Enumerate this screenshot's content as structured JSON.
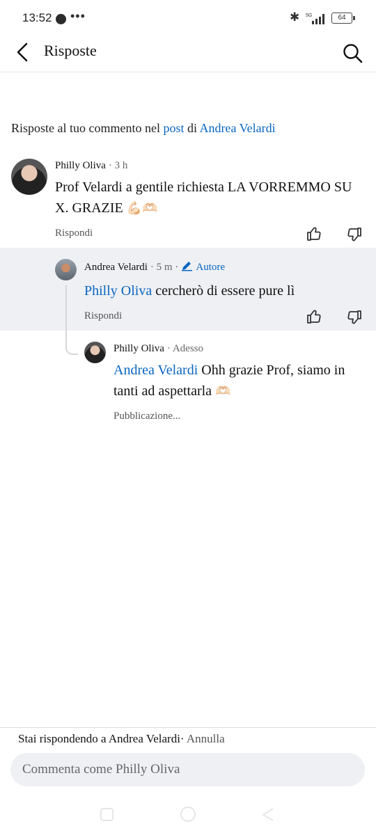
{
  "status_bar": {
    "time": "13:52",
    "battery": "64",
    "network": "5G"
  },
  "header": {
    "title": "Risposte"
  },
  "breadcrumb": {
    "prefix": "Risposte al tuo commento nel",
    "post_link": "post",
    "middle": "di",
    "author_link": "Andrea Velardi"
  },
  "comments": [
    {
      "name": "Philly Oliva",
      "time": "· 3 h",
      "text": "Prof Velardi a gentile richiesta LA VORREMMO SU X. GRAZIE",
      "emoji": "💪🏻🫶🏻",
      "reply_label": "Rispondi"
    },
    {
      "name": "Andrea Velardi",
      "time": "· 5 m ·",
      "badge": "Autore",
      "mention": "Philly Oliva",
      "text": "cercherò di essere pure lì",
      "reply_label": "Rispondi"
    },
    {
      "name": "Philly Oliva",
      "time": "· Adesso",
      "mention": "Andrea Velardi",
      "text": "Ohh grazie Prof, siamo in tanti ad aspettarla",
      "emoji": "🫶🏻",
      "status": "Pubblicazione..."
    }
  ],
  "reply_bar": {
    "prefix": "Stai rispondendo a",
    "target": "Andrea Velardi",
    "separator": "·",
    "cancel": "Annulla",
    "placeholder": "Commenta come Philly Oliva"
  }
}
